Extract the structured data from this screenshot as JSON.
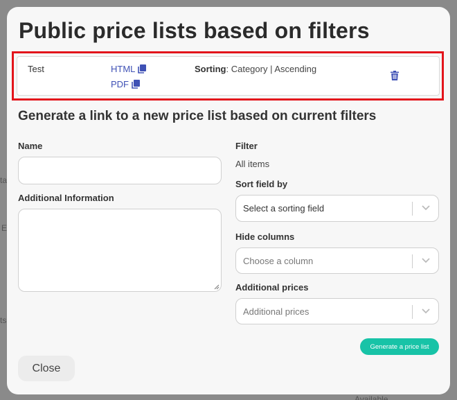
{
  "modal": {
    "title": "Public price lists based on filters",
    "price_list": {
      "name": "Test",
      "html_link": "HTML",
      "pdf_link": "PDF",
      "sorting_label": "Sorting",
      "sorting_value": ": Category | Ascending"
    },
    "subtitle": "Generate a link to a new price list based on current filters",
    "form": {
      "name_label": "Name",
      "name_value": "",
      "additional_info_label": "Additional Information",
      "additional_info_value": "",
      "filter_label": "Filter",
      "filter_value": "All items",
      "sort_label": "Sort field by",
      "sort_placeholder": "Select a sorting field",
      "hide_columns_label": "Hide columns",
      "hide_columns_placeholder": "Choose a column",
      "additional_prices_label": "Additional prices",
      "additional_prices_placeholder": "Additional prices"
    },
    "generate_button": "Generate a price list",
    "close_button": "Close"
  },
  "colors": {
    "accent": "#18c3a7",
    "link": "#3f51b5",
    "highlight": "#e3141b"
  },
  "icons": {
    "copy": "copy-icon",
    "delete": "trash-icon",
    "dropdown": "chevron-down-icon"
  }
}
